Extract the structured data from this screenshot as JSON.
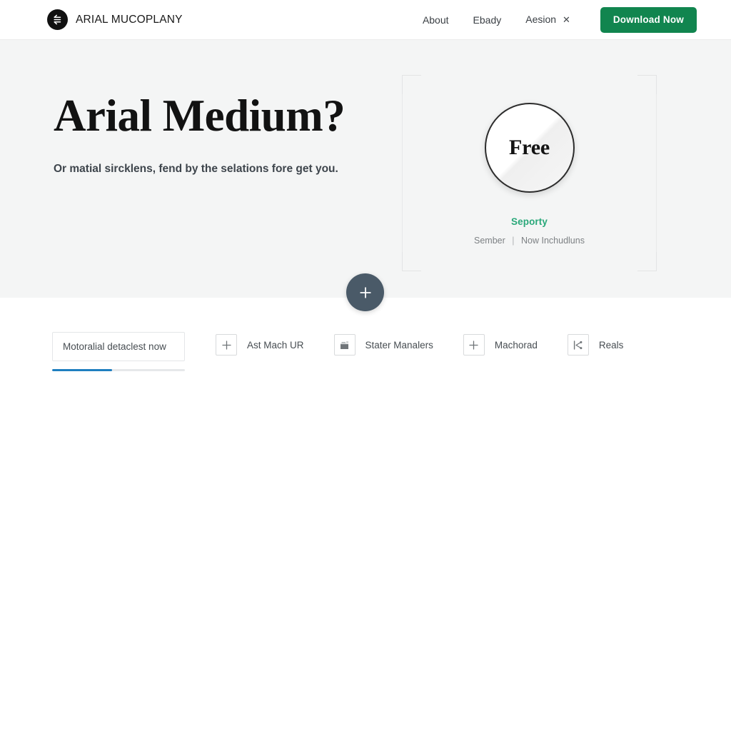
{
  "header": {
    "logo_icon": "arrow-left-circle-icon",
    "brand_name": "ARIAL MUCOPLANY",
    "nav_items": [
      {
        "label": "About",
        "icon": ""
      },
      {
        "label": "Ebady",
        "icon": ""
      },
      {
        "label": "Aesion",
        "icon": "close-x-icon",
        "suffix": "✕"
      }
    ],
    "cta_label": "Download Now",
    "cta_color": "#11854f"
  },
  "hero": {
    "title": "Arial Medium?",
    "subtitle": "Or matial sircklens, fend by the selations fore get you.",
    "background": "#f4f5f5",
    "badge": {
      "circle_label": "Free",
      "caption": "Seporty",
      "caption_color": "#2aa87a",
      "meta_left": "Sember",
      "meta_separator": "|",
      "meta_right": "Now Inchudluns"
    }
  },
  "fab": {
    "icon": "plus-icon",
    "color": "#4a5a68"
  },
  "toolbar": {
    "tab_label": "Motoralial detaclest now",
    "progress_percent": 45,
    "progress_color": "#1f7fc0",
    "items": [
      {
        "label": "Ast Mach UR",
        "icon": "plus-icon"
      },
      {
        "label": "Stater Manalers",
        "icon": "briefcase-icon"
      },
      {
        "label": "Machorad",
        "icon": "plus-icon"
      },
      {
        "label": "Reals",
        "icon": "share-icon"
      }
    ]
  }
}
